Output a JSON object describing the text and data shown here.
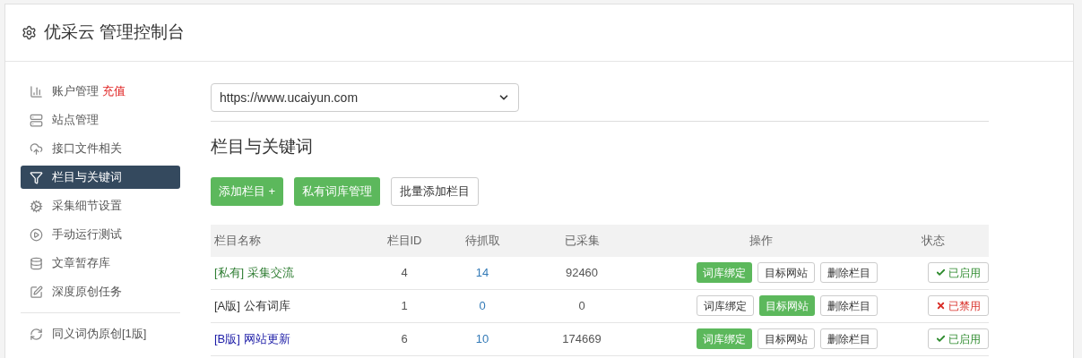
{
  "header": {
    "title": "优采云 管理控制台"
  },
  "sidebar": {
    "items": [
      {
        "label": "账户管理",
        "badge": "充值",
        "selected": false
      },
      {
        "label": "站点管理",
        "selected": false
      },
      {
        "label": "接口文件相关",
        "selected": false
      },
      {
        "label": "栏目与关键词",
        "selected": true
      },
      {
        "label": "采集细节设置",
        "selected": false
      },
      {
        "label": "手动运行测试",
        "selected": false
      },
      {
        "label": "文章暂存库",
        "selected": false
      },
      {
        "label": "深度原创任务",
        "selected": false
      }
    ],
    "footer_items": [
      {
        "label": "同义词伪原创[1版]",
        "selected": false
      }
    ]
  },
  "site_select": {
    "value": "https://www.ucaiyun.com"
  },
  "section_title": "栏目与关键词",
  "actions": [
    {
      "label": "添加栏目 +",
      "kind": "success"
    },
    {
      "label": "私有词库管理",
      "kind": "success"
    },
    {
      "label": "批量添加栏目",
      "kind": "default"
    }
  ],
  "table": {
    "columns": [
      "栏目名称",
      "栏目ID",
      "待抓取",
      "已采集",
      "操作",
      "状态"
    ],
    "rows": [
      {
        "name": "[私有] 采集交流",
        "color": "#2e7d32",
        "id": "4",
        "pending": "14",
        "collected": "92460",
        "ops": [
          {
            "label": "词库绑定",
            "selected": true
          },
          {
            "label": "目标网站",
            "selected": false
          },
          {
            "label": "删除栏目",
            "selected": false
          }
        ],
        "status": {
          "label": "已启用",
          "enabled": true
        }
      },
      {
        "name": "[A版] 公有词库",
        "color": "#333333",
        "id": "1",
        "pending": "0",
        "collected": "0",
        "ops": [
          {
            "label": "词库绑定",
            "selected": false
          },
          {
            "label": "目标网站",
            "selected": true
          },
          {
            "label": "删除栏目",
            "selected": false
          }
        ],
        "status": {
          "label": "已禁用",
          "enabled": false
        }
      },
      {
        "name": "[B版] 网站更新",
        "color": "#1a1aa6",
        "id": "6",
        "pending": "10",
        "collected": "174669",
        "ops": [
          {
            "label": "词库绑定",
            "selected": true
          },
          {
            "label": "目标网站",
            "selected": false
          },
          {
            "label": "删除栏目",
            "selected": false
          }
        ],
        "status": {
          "label": "已启用",
          "enabled": true
        }
      }
    ]
  }
}
